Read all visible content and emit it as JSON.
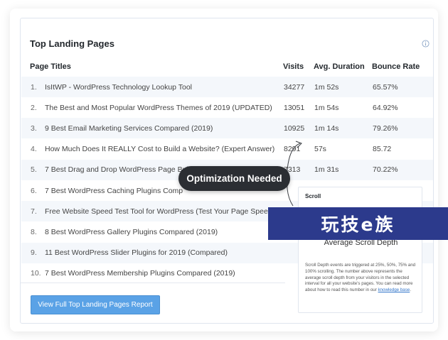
{
  "widget": {
    "title": "Top Landing Pages",
    "info_icon": "info-circle-icon"
  },
  "table": {
    "headers": {
      "title": "Page Titles",
      "visits": "Visits",
      "duration": "Avg. Duration",
      "bounce": "Bounce Rate"
    },
    "rows": [
      {
        "num": "1.",
        "title": "IsItWP - WordPress Technology Lookup Tool",
        "visits": "34277",
        "duration": "1m 52s",
        "bounce": "65.57%"
      },
      {
        "num": "2.",
        "title": "The Best and Most Popular WordPress Themes of 2019 (UPDATED)",
        "visits": "13051",
        "duration": "1m 54s",
        "bounce": "64.92%"
      },
      {
        "num": "3.",
        "title": "9 Best Email Marketing Services Compared (2019)",
        "visits": "10925",
        "duration": "1m 14s",
        "bounce": "79.26%"
      },
      {
        "num": "4.",
        "title": "How Much Does It REALLY Cost to Build a Website? (Expert Answer)",
        "visits": "8291",
        "duration": "57s",
        "bounce": "85.72"
      },
      {
        "num": "5.",
        "title": "7 Best Drag and Drop WordPress Page Builders Compared (2019)",
        "visits": "7313",
        "duration": "1m 31s",
        "bounce": "70.22%"
      },
      {
        "num": "6.",
        "title": "7 Best WordPress Caching Plugins Comp",
        "visits": "",
        "duration": "",
        "bounce": ""
      },
      {
        "num": "7.",
        "title": "Free Website Speed Test Tool for WordPress (Test Your Page Speed)",
        "visits": "",
        "duration": "",
        "bounce": ""
      },
      {
        "num": "8.",
        "title": "8 Best WordPress Gallery Plugins Compared (2019)",
        "visits": "",
        "duration": "",
        "bounce": ""
      },
      {
        "num": "9.",
        "title": "11 Best WordPress Slider Plugins for 2019 (Compared)",
        "visits": "",
        "duration": "",
        "bounce": ""
      },
      {
        "num": "10.",
        "title": "7 Best WordPress Membership Plugins Compared (2019)",
        "visits": "",
        "duration": "",
        "bounce": ""
      }
    ]
  },
  "footer": {
    "report_button": "View Full Top Landing Pages Report"
  },
  "scroll_panel": {
    "title": "Scroll",
    "subtitle": "Average Scroll Depth",
    "description": "Scroll Depth events are triggered at 25%, 50%, 75% and 100% scrolling. The number above represents the average scroll depth from your visitors in the selected interval for all your website's pages. You can read more about how to read this number in our",
    "link": "knowledge base",
    "period": "."
  },
  "callout": {
    "label": "Optimization Needed"
  },
  "brand_banner": {
    "text": "玩技e族"
  },
  "colors": {
    "button": "#5aa2e6",
    "row_shade": "#f4f7fb",
    "callout_bg": "#2b2e33",
    "banner_bg": "#2c3a8c",
    "link": "#2f73c9"
  }
}
